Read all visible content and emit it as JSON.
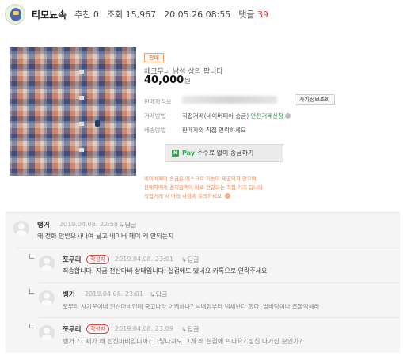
{
  "header": {
    "author": "티모뇨속",
    "recommend": "추천 0",
    "views": "조회 15,967",
    "datetime": "20.05.26 08:55",
    "comments_label": "댓글",
    "comments_count": "39"
  },
  "product": {
    "badge": "판매",
    "title": "체크무늬 남성 상의 팝니다",
    "price": "40,000",
    "price_unit": "원",
    "seller_label": "판매자정보",
    "fraud_button": "사기정보조회",
    "trade_label": "거래방법",
    "trade_value": "직접거래(네이버페이 송금)",
    "trade_link": "안전거래신청",
    "delivery_label": "배송방법",
    "delivery_value": "판매자와 직접 연락하세요",
    "pay_icon": "N",
    "pay_word": "Pay",
    "pay_button": "수수료 없이 송금하기",
    "notice_1": "네이버페이 송금은 에스크로 기능이 제공되지 않으며,",
    "notice_2": "판매자에게 결제금액이 바로 전달되는 직접 거래 입니다.",
    "notice_3": "직접거래 시 아래 사항에 유의하세요."
  },
  "comments": [
    {
      "name": "뱅거",
      "writer_badge": "",
      "date": "2019.04.08. 22:58",
      "reply": "답글",
      "text": "왜 전화 안받으시나여 글고 네이버 페이 왜 안되는지"
    },
    {
      "name": "쪼무리",
      "writer_badge": "작성자",
      "date": "2019.04.08. 23:01",
      "reply": "답글",
      "text": "죄송합니다. 지금 전산마비 상태입니다. 실검에도 떴네요 카톡으로 연락주세요"
    },
    {
      "name": "뱅거",
      "writer_badge": "",
      "date": "2019.04.08. 23:01",
      "reply": "답글",
      "text": "쪼무리 사기꾼이네 전산마비인데 중고나라 어케하냐? 닉네임부터 냄새난다 했다. 발바닥이나 쪼물딱해라"
    },
    {
      "name": "쪼무리",
      "writer_badge": "작성자",
      "date": "2019.04.08. 23:09",
      "reply": "답글",
      "text": "뱅거 ?.. 제가 왜 전신마비입니까? 그렇다쳐도 그게 왜 실검에 뜨나요? 정신 나가신 분인가?"
    }
  ],
  "colors": {
    "accent_red": "#e23b3b",
    "pay_green": "#1fb34a",
    "notice_orange": "#e88a58"
  }
}
